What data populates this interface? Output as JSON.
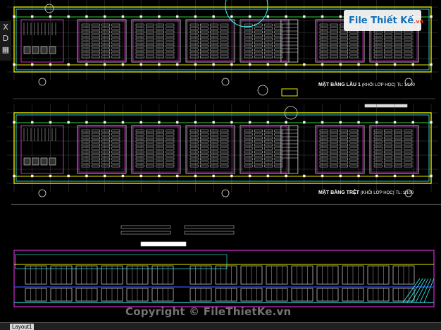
{
  "window": {
    "layout_tab_label": "Layout1",
    "toolbar_glyphs": [
      "X",
      "D",
      "▦"
    ]
  },
  "plans": [
    {
      "title": "MẶT BẰNG LẦU 1",
      "subtitle": "(KHỐI LỚP HỌC)",
      "scale": "TL: 1/100"
    },
    {
      "title": "MẶT BẰNG TRỆT",
      "subtitle": "(KHỐI LỚP HỌC)",
      "scale": "TL: 1/100"
    }
  ],
  "watermark": {
    "logo_text": "File Thiết Kế",
    "logo_suffix": ".vn",
    "copyright": "Copyright © FileThietKe.vn"
  },
  "colors": {
    "background": "#000000",
    "line_yellow": "#e6e600",
    "line_magenta": "#ff33ff",
    "line_cyan": "#33ffff",
    "line_white": "#dddddd",
    "line_green": "#33cc33",
    "line_blue": "#3355ff",
    "logo_blue": "#0d6fb8"
  },
  "icons": {
    "logo": "monitor-bulb-icon"
  }
}
